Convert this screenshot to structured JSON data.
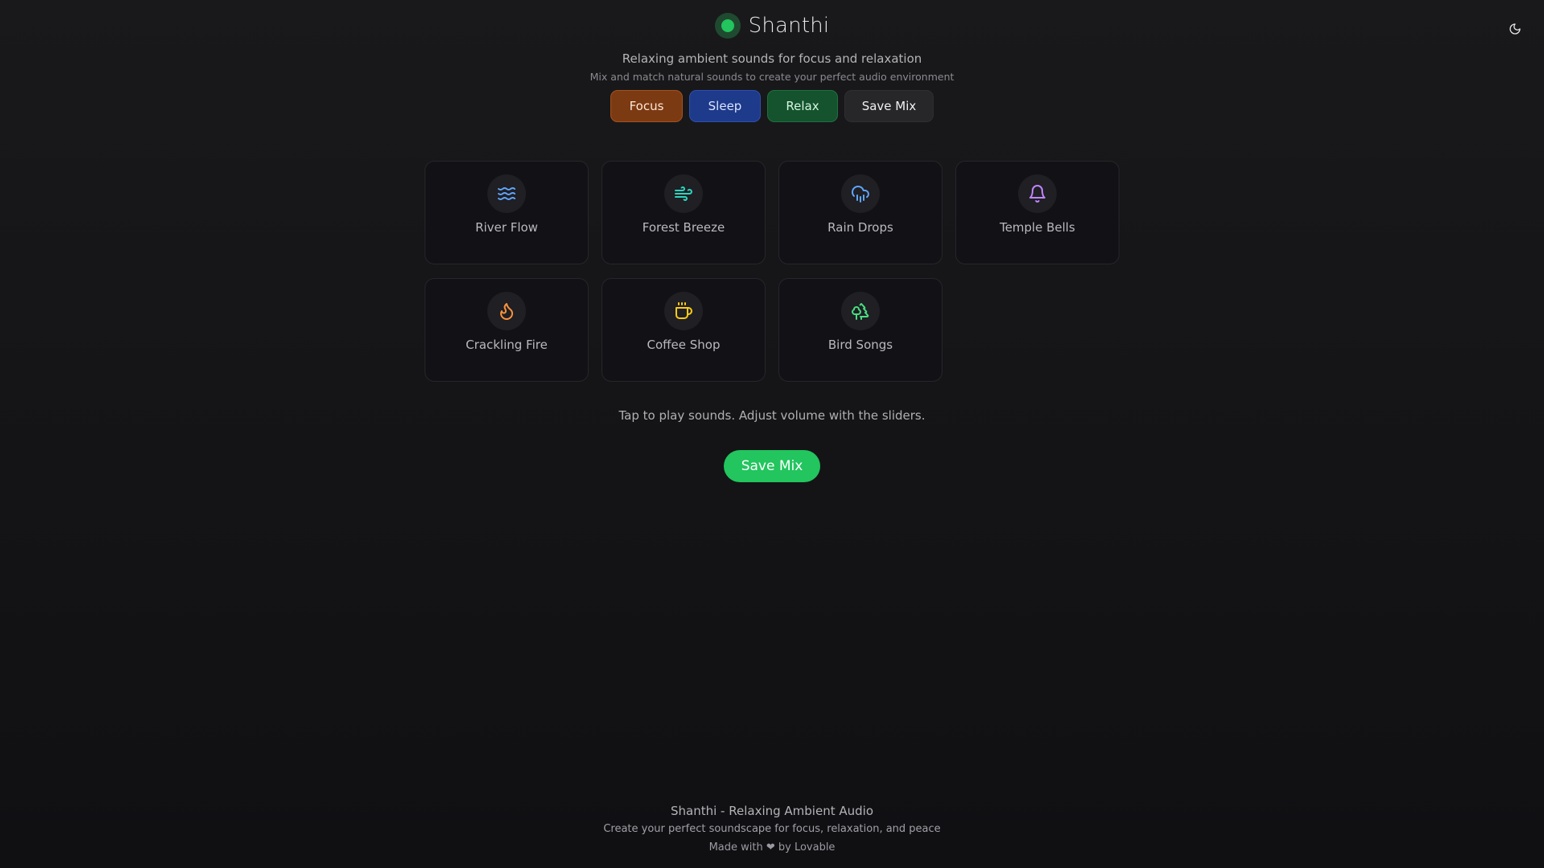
{
  "app": {
    "name": "Shanthi",
    "tagline": "Relaxing ambient sounds for focus and relaxation",
    "subtagline": "Mix and match natural sounds to create your perfect audio environment",
    "brand_color": "#22c55e"
  },
  "theme_toggle": {
    "icon": "moon-icon"
  },
  "presets": [
    {
      "label": "Focus",
      "color": "#7c3a12"
    },
    {
      "label": "Sleep",
      "color": "#1e3a8a"
    },
    {
      "label": "Relax",
      "color": "#14532d"
    },
    {
      "label": "Save Mix",
      "color": "#27272a"
    }
  ],
  "sounds": [
    {
      "label": "River Flow",
      "icon": "waves-icon",
      "color": "#60a5fa"
    },
    {
      "label": "Forest Breeze",
      "icon": "wind-icon",
      "color": "#2dd4bf"
    },
    {
      "label": "Rain Drops",
      "icon": "cloud-rain-icon",
      "color": "#60a5fa"
    },
    {
      "label": "Temple Bells",
      "icon": "bell-icon",
      "color": "#c084fc"
    },
    {
      "label": "Crackling Fire",
      "icon": "flame-icon",
      "color": "#fb923c"
    },
    {
      "label": "Coffee Shop",
      "icon": "coffee-icon",
      "color": "#facc15"
    },
    {
      "label": "Bird Songs",
      "icon": "trees-icon",
      "color": "#4ade80"
    }
  ],
  "hint": "Tap to play sounds. Adjust volume with the sliders.",
  "save_button": {
    "label": "Save Mix"
  },
  "footer": {
    "title": "Shanthi - Relaxing Ambient Audio",
    "subtitle": "Create your perfect soundscape for focus, relaxation, and peace",
    "made_with": "Made with ❤ by Lovable"
  }
}
